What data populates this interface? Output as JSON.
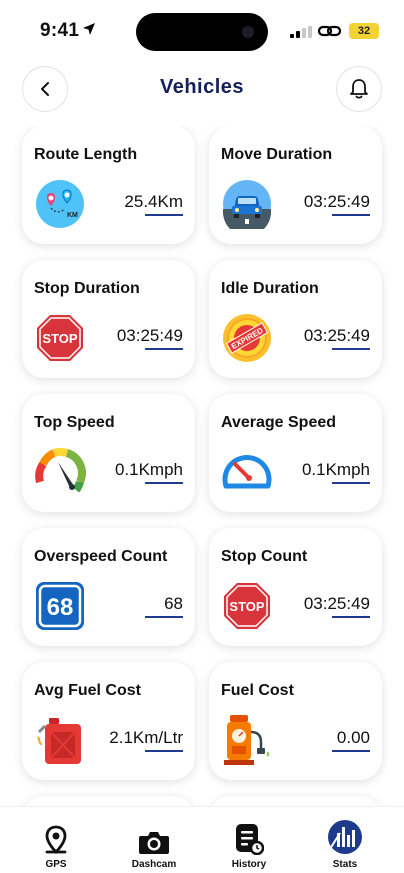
{
  "status_bar": {
    "time": "9:41",
    "battery": "32"
  },
  "header": {
    "title": "Vehicles"
  },
  "cards": [
    {
      "label": "Route Length",
      "value": "25.4Km",
      "icon": "route-map-icon"
    },
    {
      "label": "Move Duration",
      "value": "03:25:49",
      "icon": "car-road-icon"
    },
    {
      "label": "Stop Duration",
      "value": "03:25:49",
      "icon": "stop-sign-icon"
    },
    {
      "label": "Idle Duration",
      "value": "03:25:49",
      "icon": "expired-badge-icon"
    },
    {
      "label": "Top Speed",
      "value": "0.1Kmph",
      "icon": "speed-gauge-icon"
    },
    {
      "label": "Average Speed",
      "value": "0.1Kmph",
      "icon": "speedometer-icon"
    },
    {
      "label": "Overspeed Count",
      "value": "68",
      "icon": "speed-limit-68-icon",
      "badge": "68"
    },
    {
      "label": "Stop Count",
      "value": "03:25:49",
      "icon": "stop-sign-icon"
    },
    {
      "label": "Avg Fuel Cost",
      "value": "2.1Km/Ltr",
      "icon": "fuel-can-icon"
    },
    {
      "label": "Fuel Cost",
      "value": "0.00",
      "icon": "fuel-pump-icon"
    }
  ],
  "icon_text": {
    "stop": "STOP",
    "expired": "EXPIRED"
  },
  "nav": [
    {
      "label": "GPS",
      "icon": "map-pin-icon"
    },
    {
      "label": "Dashcam",
      "icon": "camera-icon"
    },
    {
      "label": "History",
      "icon": "history-icon"
    },
    {
      "label": "Stats",
      "icon": "stats-icon"
    }
  ],
  "colors": {
    "title": "#14205a",
    "underline": "#1f3a93",
    "stop_red": "#d8343b",
    "speed_blue": "#1e88e5"
  }
}
